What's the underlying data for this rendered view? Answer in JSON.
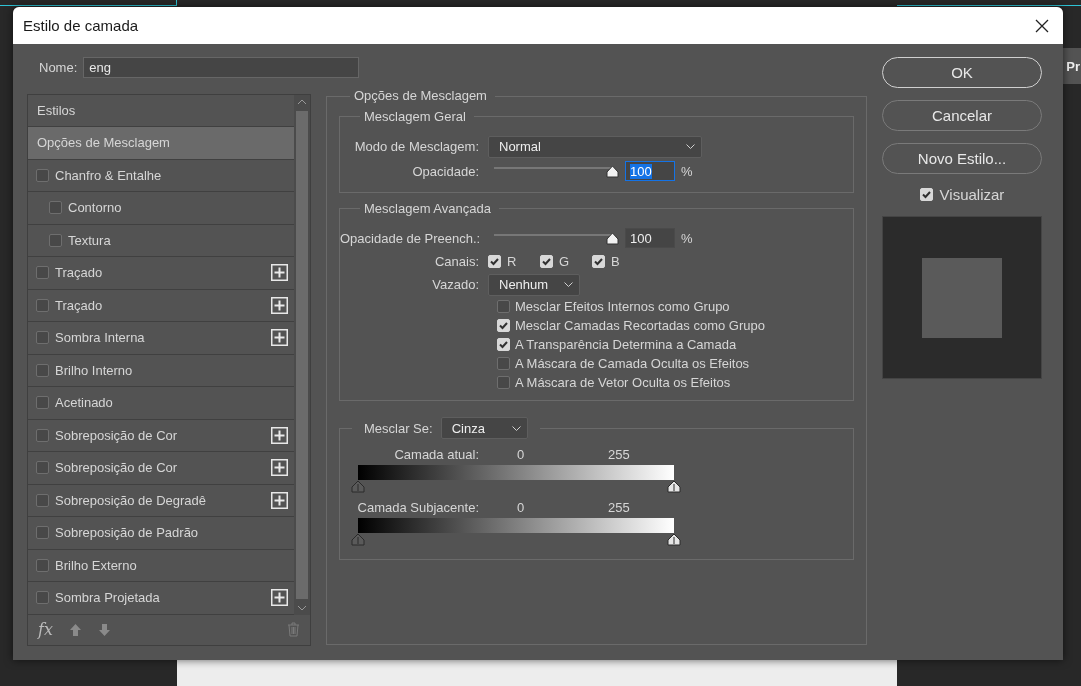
{
  "background": {
    "side_tab": "Pr"
  },
  "dialog": {
    "title": "Estilo de camada"
  },
  "name_field": {
    "label": "Nome:",
    "value": "eng"
  },
  "styles_list": {
    "header": "Estilos",
    "items": [
      {
        "label": "Opções de Mesclagem",
        "kind": "plain",
        "selected": true
      },
      {
        "label": "Chanfro & Entalhe",
        "kind": "check",
        "checked": false,
        "selected": false,
        "addable": false,
        "children": [
          {
            "label": "Contorno",
            "kind": "check",
            "checked": false,
            "selected": false,
            "addable": false
          },
          {
            "label": "Textura",
            "kind": "check",
            "checked": false,
            "selected": false,
            "addable": false
          }
        ]
      },
      {
        "label": "Traçado",
        "kind": "check",
        "checked": false,
        "selected": false,
        "addable": true
      },
      {
        "label": "Traçado",
        "kind": "check",
        "checked": false,
        "selected": false,
        "addable": true
      },
      {
        "label": "Sombra Interna",
        "kind": "check",
        "checked": false,
        "selected": false,
        "addable": true
      },
      {
        "label": "Brilho Interno",
        "kind": "check",
        "checked": false,
        "selected": false,
        "addable": false
      },
      {
        "label": "Acetinado",
        "kind": "check",
        "checked": false,
        "selected": false,
        "addable": false
      },
      {
        "label": "Sobreposição de Cor",
        "kind": "check",
        "checked": false,
        "selected": false,
        "addable": true
      },
      {
        "label": "Sobreposição de Cor",
        "kind": "check",
        "checked": false,
        "selected": false,
        "addable": true
      },
      {
        "label": "Sobreposição de Degradê",
        "kind": "check",
        "checked": false,
        "selected": false,
        "addable": true
      },
      {
        "label": "Sobreposição de Padrão",
        "kind": "check",
        "checked": false,
        "selected": false,
        "addable": false
      },
      {
        "label": "Brilho Externo",
        "kind": "check",
        "checked": false,
        "selected": false,
        "addable": false
      },
      {
        "label": "Sombra Projetada",
        "kind": "check",
        "checked": false,
        "selected": false,
        "addable": true
      }
    ],
    "footer_fx": "fx"
  },
  "blending_options": {
    "title": "Opções de Mesclagem",
    "general": {
      "title": "Mesclagem Geral",
      "mode_label": "Modo de Mesclagem:",
      "mode_value": "Normal",
      "opacity_label": "Opacidade:",
      "opacity": {
        "level": 1,
        "value": "100",
        "unit": "%",
        "focused": true
      }
    },
    "advanced": {
      "title": "Mesclagem Avançada",
      "fill_label": "Opacidade de Preench.:",
      "fill": {
        "level": 1,
        "value": "100",
        "unit": "%",
        "focused": false
      },
      "channels_label": "Canais:",
      "channels": [
        {
          "label": "R",
          "checked": true
        },
        {
          "label": "G",
          "checked": true
        },
        {
          "label": "B",
          "checked": true
        }
      ],
      "knockout_label": "Vazado:",
      "knockout_value": "Nenhum",
      "options": [
        {
          "label": "Mesclar Efeitos Internos como Grupo",
          "checked": false
        },
        {
          "label": "Mesclar Camadas Recortadas como Grupo",
          "checked": true
        },
        {
          "label": "A Transparência Determina a Camada",
          "checked": true
        },
        {
          "label": "A Máscara de Camada Oculta os Efeitos",
          "checked": false
        },
        {
          "label": "A Máscara de Vetor Oculta os Efeitos",
          "checked": false
        }
      ]
    },
    "blend_if": {
      "label": "Mesclar Se:",
      "value": "Cinza",
      "rows": [
        {
          "label": "Camada atual:",
          "low": "0",
          "high": "255"
        },
        {
          "label": "Camada Subjacente:",
          "low": "0",
          "high": "255"
        }
      ]
    }
  },
  "buttons": [
    {
      "label": "OK",
      "default": true
    },
    {
      "label": "Cancelar",
      "default": false
    },
    {
      "label": "Novo Estilo...",
      "default": false
    }
  ],
  "preview": {
    "label": "Visualizar",
    "checked": true
  }
}
